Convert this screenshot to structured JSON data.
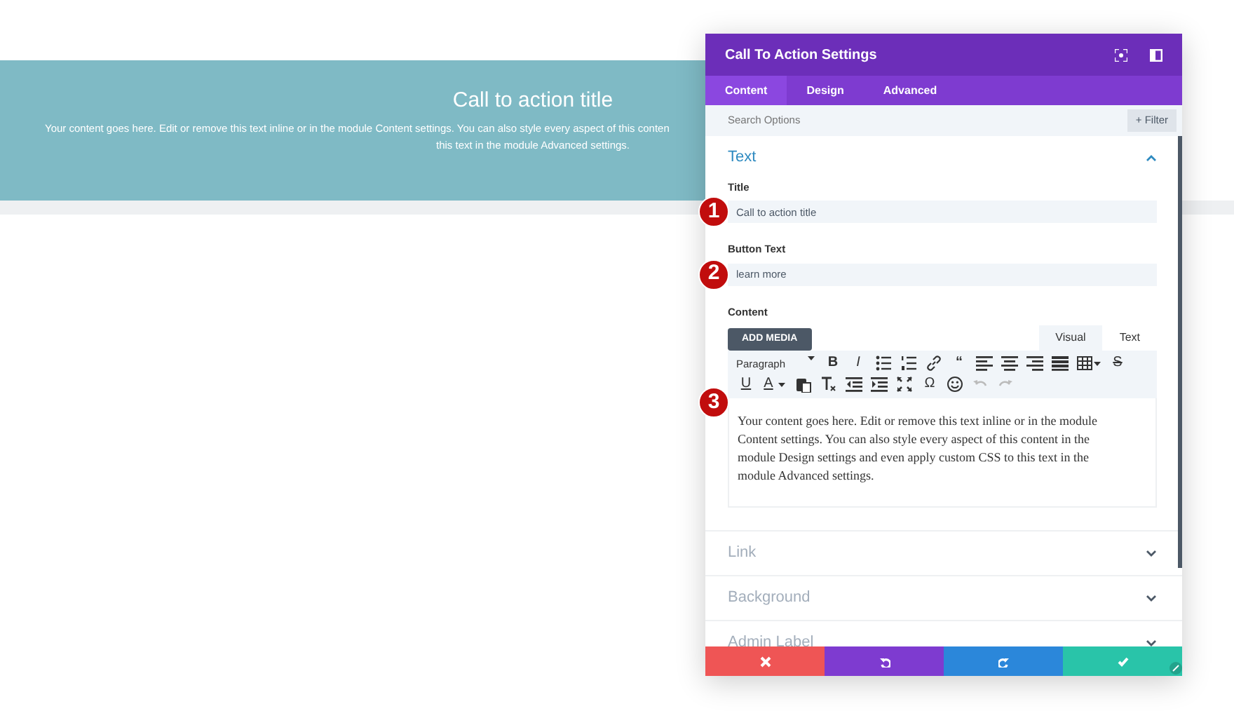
{
  "page": {
    "cta_title": "Call to action title",
    "cta_lines": [
      "Your content goes here. Edit or remove this text inline or in the module Content settings. You can also style every aspect of this conten",
      "this text in the module Advanced settings."
    ]
  },
  "panel": {
    "title": "Call To Action Settings",
    "tabs": [
      {
        "label": "Content",
        "selected": true
      },
      {
        "label": "Design",
        "selected": false
      },
      {
        "label": "Advanced",
        "selected": false
      }
    ],
    "search": {
      "placeholder": "Search Options"
    },
    "filter_button": "+ Filter",
    "sections": [
      {
        "title": "Text",
        "expanded": true,
        "fields": [
          {
            "kind": "input",
            "label": "Title",
            "value": "Call to action title"
          },
          {
            "kind": "input",
            "label": "Button Text",
            "value": "learn more"
          },
          {
            "kind": "editor",
            "label": "Content",
            "add_media": "ADD MEDIA",
            "editor_tabs": [
              {
                "label": "Visual",
                "selected": true
              },
              {
                "label": "Text",
                "selected": false
              }
            ],
            "format_select": "Paragraph",
            "toolbar": [
              [
                {
                  "kind": "bold",
                  "text": "B"
                },
                {
                  "kind": "italic",
                  "text": "I"
                },
                {
                  "kind": "bullets"
                },
                {
                  "kind": "numbers"
                },
                {
                  "kind": "link"
                },
                {
                  "kind": "quote",
                  "text": "“"
                },
                {
                  "kind": "align-left"
                },
                {
                  "kind": "align-center"
                },
                {
                  "kind": "align-right"
                },
                {
                  "kind": "justify"
                },
                {
                  "kind": "table"
                },
                {
                  "kind": "strike",
                  "text": "S"
                }
              ],
              [
                {
                  "kind": "underline",
                  "text": "U"
                },
                {
                  "kind": "color-glyph",
                  "text": "A"
                },
                {
                  "kind": "paste"
                },
                {
                  "kind": "clear"
                },
                {
                  "kind": "outdent"
                },
                {
                  "kind": "indent"
                },
                {
                  "kind": "fullscreen"
                },
                {
                  "kind": "symbol",
                  "text": "Ω"
                },
                {
                  "kind": "emoji"
                },
                {
                  "kind": "undo",
                  "disabled": true
                },
                {
                  "kind": "redo",
                  "disabled": true
                }
              ]
            ],
            "content": "Your content goes here. Edit or remove this text inline or in the module Content settings. You can also style every aspect of this content in the module Design settings and even apply custom CSS to this text in the module Advanced settings."
          }
        ]
      },
      {
        "title": "Link",
        "expanded": false
      },
      {
        "title": "Background",
        "expanded": false
      },
      {
        "title": "Admin Label",
        "expanded": false
      }
    ],
    "footer_buttons": [
      {
        "kind": "discard"
      },
      {
        "kind": "undo"
      },
      {
        "kind": "redo"
      },
      {
        "kind": "save"
      }
    ]
  },
  "callouts": [
    "1",
    "2",
    "3"
  ]
}
